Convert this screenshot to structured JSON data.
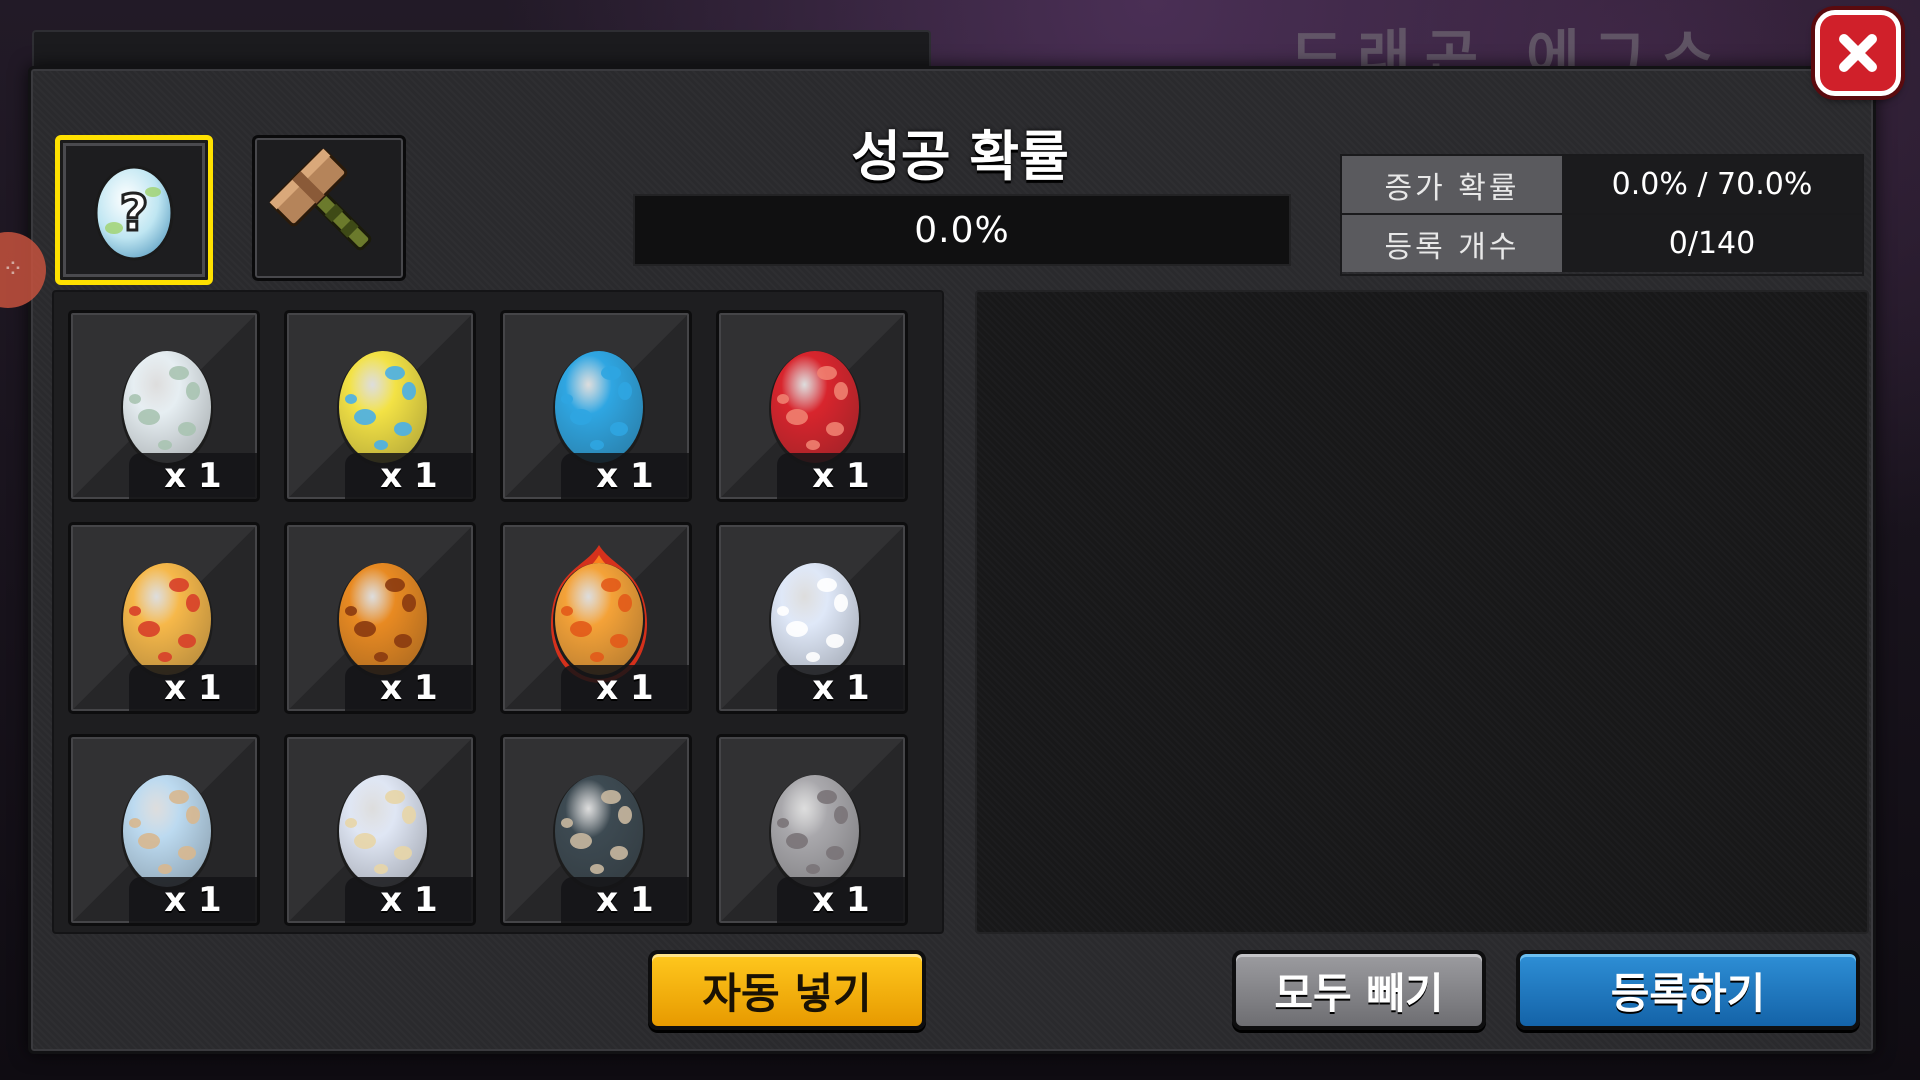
{
  "background": {
    "title": "드래곤 에그스"
  },
  "header": {
    "success_title": "성공 확률",
    "success_rate": "0.0%"
  },
  "info": {
    "rows": [
      {
        "label": "증가 확률",
        "value": "0.0% / 70.0%"
      },
      {
        "label": "등록 개수",
        "value": "0/140"
      }
    ]
  },
  "tools": [
    {
      "name": "mystery-egg-icon",
      "selected": true
    },
    {
      "name": "hammer-icon",
      "selected": false
    }
  ],
  "eggs": [
    {
      "color": "#e6eef2",
      "spots": "#a9c4b2",
      "count": "x 1"
    },
    {
      "color": "#f3e245",
      "spots": "#4ab0e8",
      "count": "x 1"
    },
    {
      "color": "#2fa6e2",
      "spots": "#2fa6e2",
      "count": "x 1"
    },
    {
      "color": "#d8252d",
      "spots": "#f08070",
      "count": "x 1"
    },
    {
      "color": "#f6b84a",
      "spots": "#d8402a",
      "count": "x 1"
    },
    {
      "color": "#e88a22",
      "spots": "#8a3a10",
      "count": "x 1"
    },
    {
      "color": "#f4a238",
      "spots": "#e35a1a",
      "count": "x 1",
      "flame": true
    },
    {
      "color": "#dfe8f8",
      "spots": "#ffffff",
      "count": "x 1"
    },
    {
      "color": "#bcdaf0",
      "spots": "#d8b890",
      "count": "x 1"
    },
    {
      "color": "#dfe6f4",
      "spots": "#e8d6a8",
      "count": "x 1"
    },
    {
      "color": "#3d4a52",
      "spots": "#c8b8a0",
      "count": "x 1"
    },
    {
      "color": "#a9a8ac",
      "spots": "#7a7478",
      "count": "x 1"
    }
  ],
  "buttons": {
    "auto_fill": "자동 넣기",
    "remove_all": "모두 빼기",
    "register": "등록하기"
  }
}
